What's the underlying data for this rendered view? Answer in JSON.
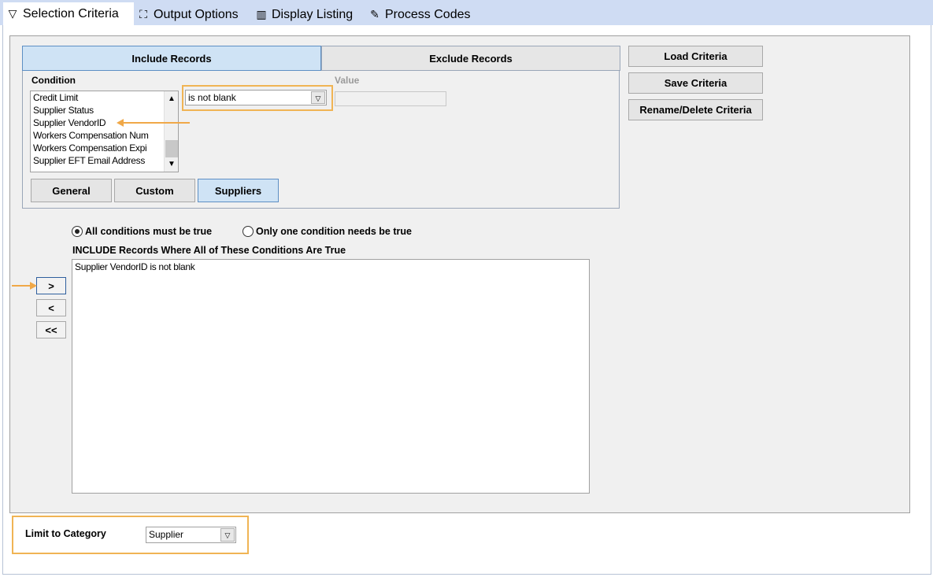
{
  "tabs": [
    {
      "icon": "filter-icon",
      "label": "Selection Criteria"
    },
    {
      "icon": "output-icon",
      "label": "Output Options"
    },
    {
      "icon": "table-icon",
      "label": "Display Listing"
    },
    {
      "icon": "process-icon",
      "label": "Process Codes"
    }
  ],
  "record_tabs": {
    "include": "Include Records",
    "exclude": "Exclude Records"
  },
  "condition": {
    "header": "Condition",
    "value_header": "Value",
    "fields": [
      "Credit Limit",
      "Supplier Status",
      "Supplier VendorID",
      "Workers Compensation Num",
      "Workers Compensation Expi",
      "Supplier EFT Email Address"
    ],
    "operator": "is not blank",
    "value": ""
  },
  "category_buttons": [
    "General",
    "Custom",
    "Suppliers"
  ],
  "criteria_buttons": [
    "Load Criteria",
    "Save Criteria",
    "Rename/Delete Criteria"
  ],
  "match": {
    "all_label": "All conditions must be true",
    "one_label": "Only one condition needs be true",
    "selected": "all"
  },
  "conditions_header": "INCLUDE Records Where All of These Conditions Are True",
  "conditions": [
    "Supplier VendorID is not blank"
  ],
  "move_buttons": [
    ">",
    "<",
    "<<"
  ],
  "limit": {
    "label": "Limit to Category",
    "value": "Supplier"
  },
  "colors": {
    "accent_highlight": "#f0b454",
    "selected_tab": "#cfe3f5",
    "tab_strip": "#cfdcf3"
  }
}
